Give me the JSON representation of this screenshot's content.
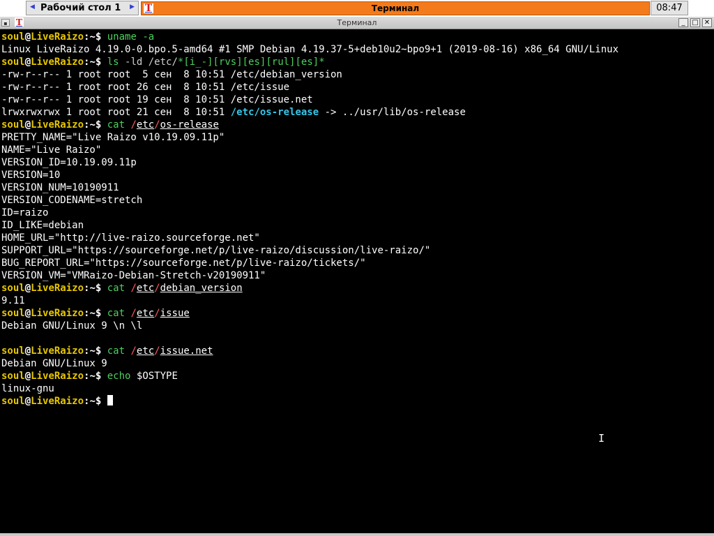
{
  "panel": {
    "desktop_name": "Рабочий стол 1",
    "prev_arrow": "◀",
    "next_arrow": "▶",
    "task_icon": "T",
    "task_title": "Терминал",
    "clock": "08:47"
  },
  "window": {
    "menu_glyph": "▪",
    "icon": "T",
    "title": "Терминал",
    "min": "_",
    "max": "□",
    "close": "✕"
  },
  "terminal": {
    "prompt": {
      "user": "soul",
      "at": "@",
      "host": "LiveRaizo",
      "colon": ":",
      "path": "~",
      "sign": "$ "
    },
    "cmd1": "uname -a",
    "uname_out": "Linux LiveRaizo 4.19.0-0.bpo.5-amd64 #1 SMP Debian 4.19.37-5+deb10u2~bpo9+1 (2019-08-16) x86_64 GNU/Linux",
    "cmd2": {
      "ls": "ls",
      "opts": " -ld /etc/",
      "glob": "*[i_-][rvs][es][rul][es]*"
    },
    "ls_lines": [
      "-rw-r--r-- 1 root root  5 сен  8 10:51 /etc/debian_version",
      "-rw-r--r-- 1 root root 26 сен  8 10:51 /etc/issue",
      "-rw-r--r-- 1 root root 19 сен  8 10:51 /etc/issue.net"
    ],
    "ls_link": {
      "prefix": "lrwxrwxrwx 1 root root 21 сен  8 10:51 ",
      "name": "/etc/os-release",
      "target": " -> ../usr/lib/os-release"
    },
    "cat": "cat",
    "slash": "/",
    "etc": "etc",
    "file_os": "os-release",
    "os_release": [
      "PRETTY_NAME=\"Live Raizo v10.19.09.11p\"",
      "NAME=\"Live Raizo\"",
      "VERSION_ID=10.19.09.11p",
      "VERSION=10",
      "VERSION_NUM=10190911",
      "VERSION_CODENAME=stretch",
      "ID=raizo",
      "ID_LIKE=debian",
      "HOME_URL=\"http://live-raizo.sourceforge.net\"",
      "SUPPORT_URL=\"https://sourceforge.net/p/live-raizo/discussion/live-raizo/\"",
      "BUG_REPORT_URL=\"https://sourceforge.net/p/live-raizo/tickets/\"",
      "VERSION_VM=\"VMRaizo-Debian-Stretch-v20190911\""
    ],
    "file_debver": "debian_version",
    "debver_out": "9.11",
    "file_issue": "issue",
    "issue_out": "Debian GNU/Linux 9 \\n \\l",
    "file_issuenet": "issue.net",
    "issuenet_out": "Debian GNU/Linux 9",
    "echo": "echo",
    "echo_arg": " $OSTYPE",
    "ostype_out": "linux-gnu"
  },
  "colors": {
    "user": "#e6c600",
    "command": "#4cd05c",
    "symlink": "#36c6e8",
    "task_button": "#f47b1c"
  },
  "icons": [
    "terminal-icon",
    "arrow-left-icon",
    "arrow-right-icon",
    "minimize-icon",
    "maximize-icon",
    "close-icon",
    "text-cursor-icon"
  ]
}
